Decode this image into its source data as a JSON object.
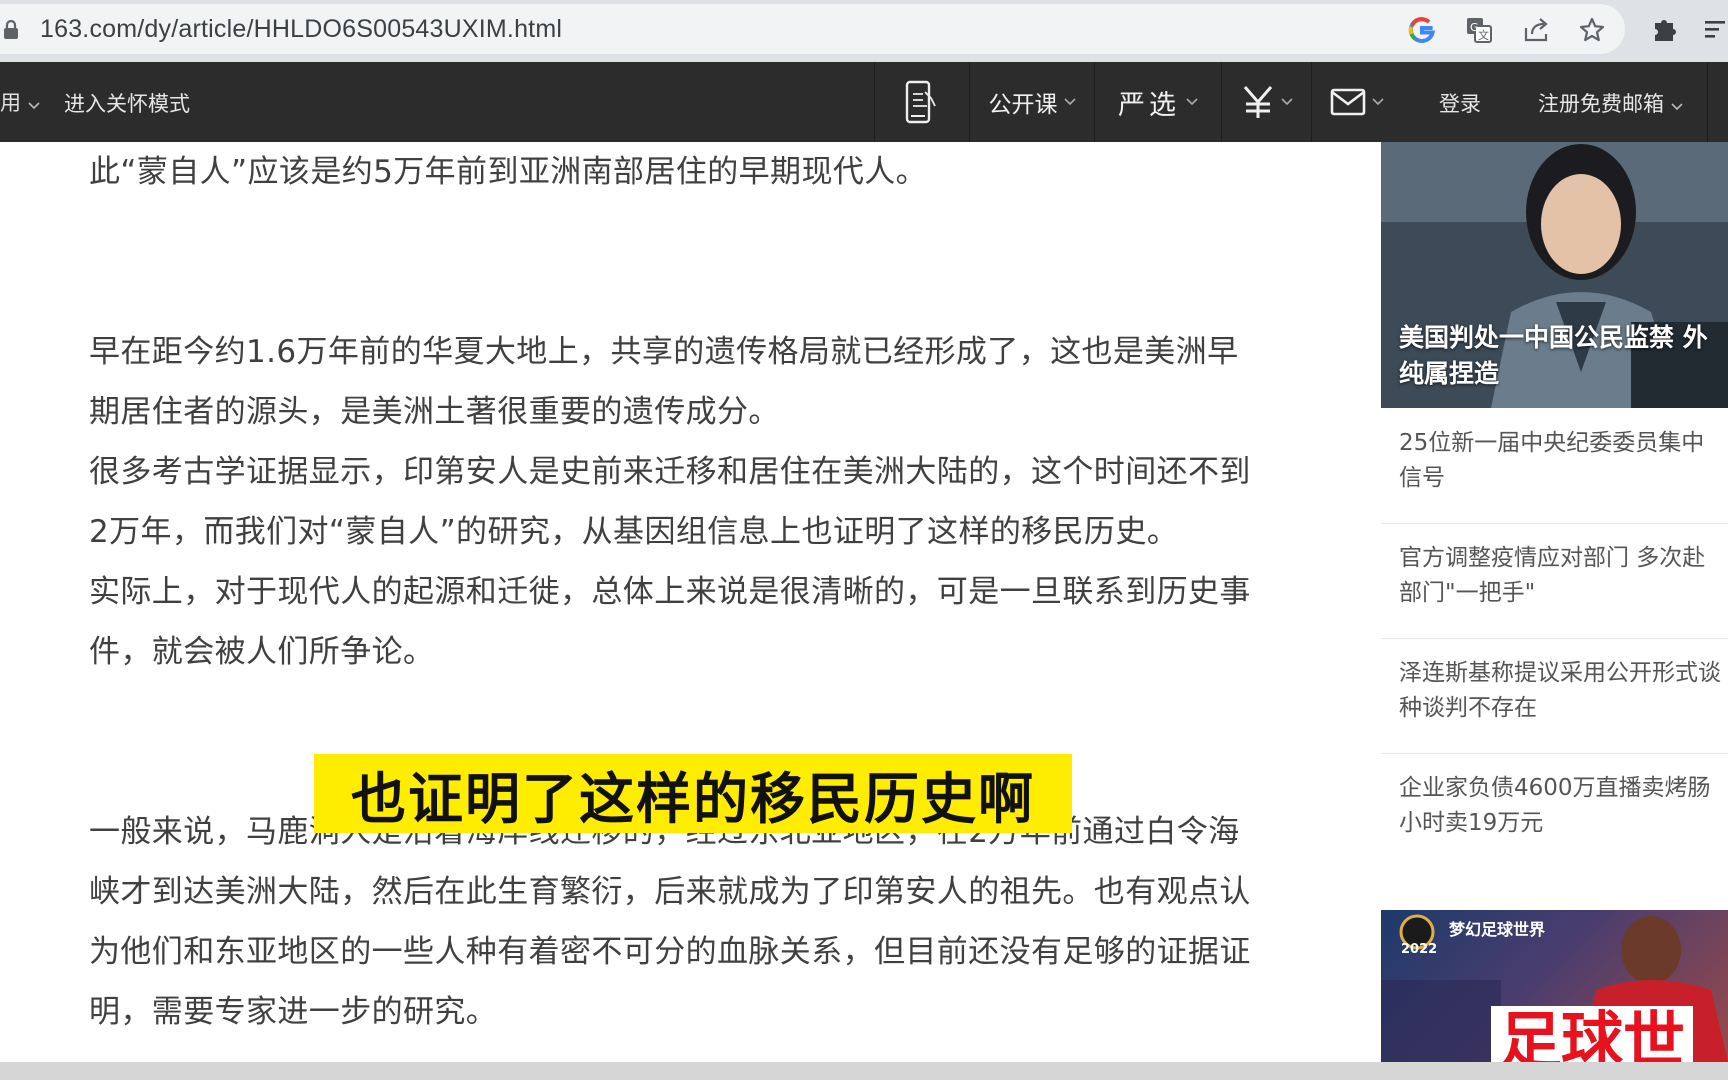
{
  "browser": {
    "url": "163.com/dy/article/HHLDO6S00543UXIM.html"
  },
  "site_nav": {
    "left_item": "用",
    "care_mode": "进入关怀模式",
    "open_course": "公开课",
    "yanxuan": "严选",
    "login": "登录",
    "register_mail": "注册免费邮箱"
  },
  "article": {
    "paragraphs": [
      "此“蒙自人”应该是约5万年前到亚洲南部居住的早期现代人。",
      "早在距今约1.6万年前的华夏大地上，共享的遗传格局就已经形成了，这也是美洲早",
      "期居住者的源头，是美洲土著很重要的遗传成分。",
      "很多考古学证据显示，印第安人是史前来迁移和居住在美洲大陆的，这个时间还不到",
      "2万年，而我们对“蒙自人”的研究，从基因组信息上也证明了这样的移民历史。",
      "实际上，对于现代人的起源和迁徙，总体上来说是很清晰的，可是一旦联系到历史事",
      "件，就会被人们所争论。",
      "一般来说，马鹿洞人是沿着海岸线迁移的，经过东北亚地区，在2万年前通过白令海",
      "峡才到达美洲大陆，然后在此生育繁衍，后来就成为了印第安人的祖先。也有观点认",
      "为他们和东亚地区的一些人种有着密不可分的血脉关系，但目前还没有足够的证据证",
      "明，需要专家进一步的研究。"
    ]
  },
  "subtitle": "也证明了这样的移民历史啊",
  "sidebar": {
    "hero_title_1": "美国判处一中国公民监禁 外",
    "hero_title_2": "纯属捏造",
    "items": [
      {
        "line1": "25位新一届中央纪委委员集中",
        "line2": "信号"
      },
      {
        "line1": "官方调整疫情应对部门 多次赴",
        "line2": "部门\"一把手\""
      },
      {
        "line1": "泽连斯基称提议采用公开形式谈",
        "line2": "种谈判不存在"
      },
      {
        "line1": "企业家负债4600万直播卖烤肠",
        "line2": "小时卖19万元"
      }
    ],
    "ad_title": "梦幻足球世界",
    "ad_badge": "2022",
    "ad_big": "足球世"
  },
  "colors": {
    "nav_bg": "#2c2c2c",
    "subtitle_bg": "#ffed00",
    "body_text": "#404040"
  }
}
